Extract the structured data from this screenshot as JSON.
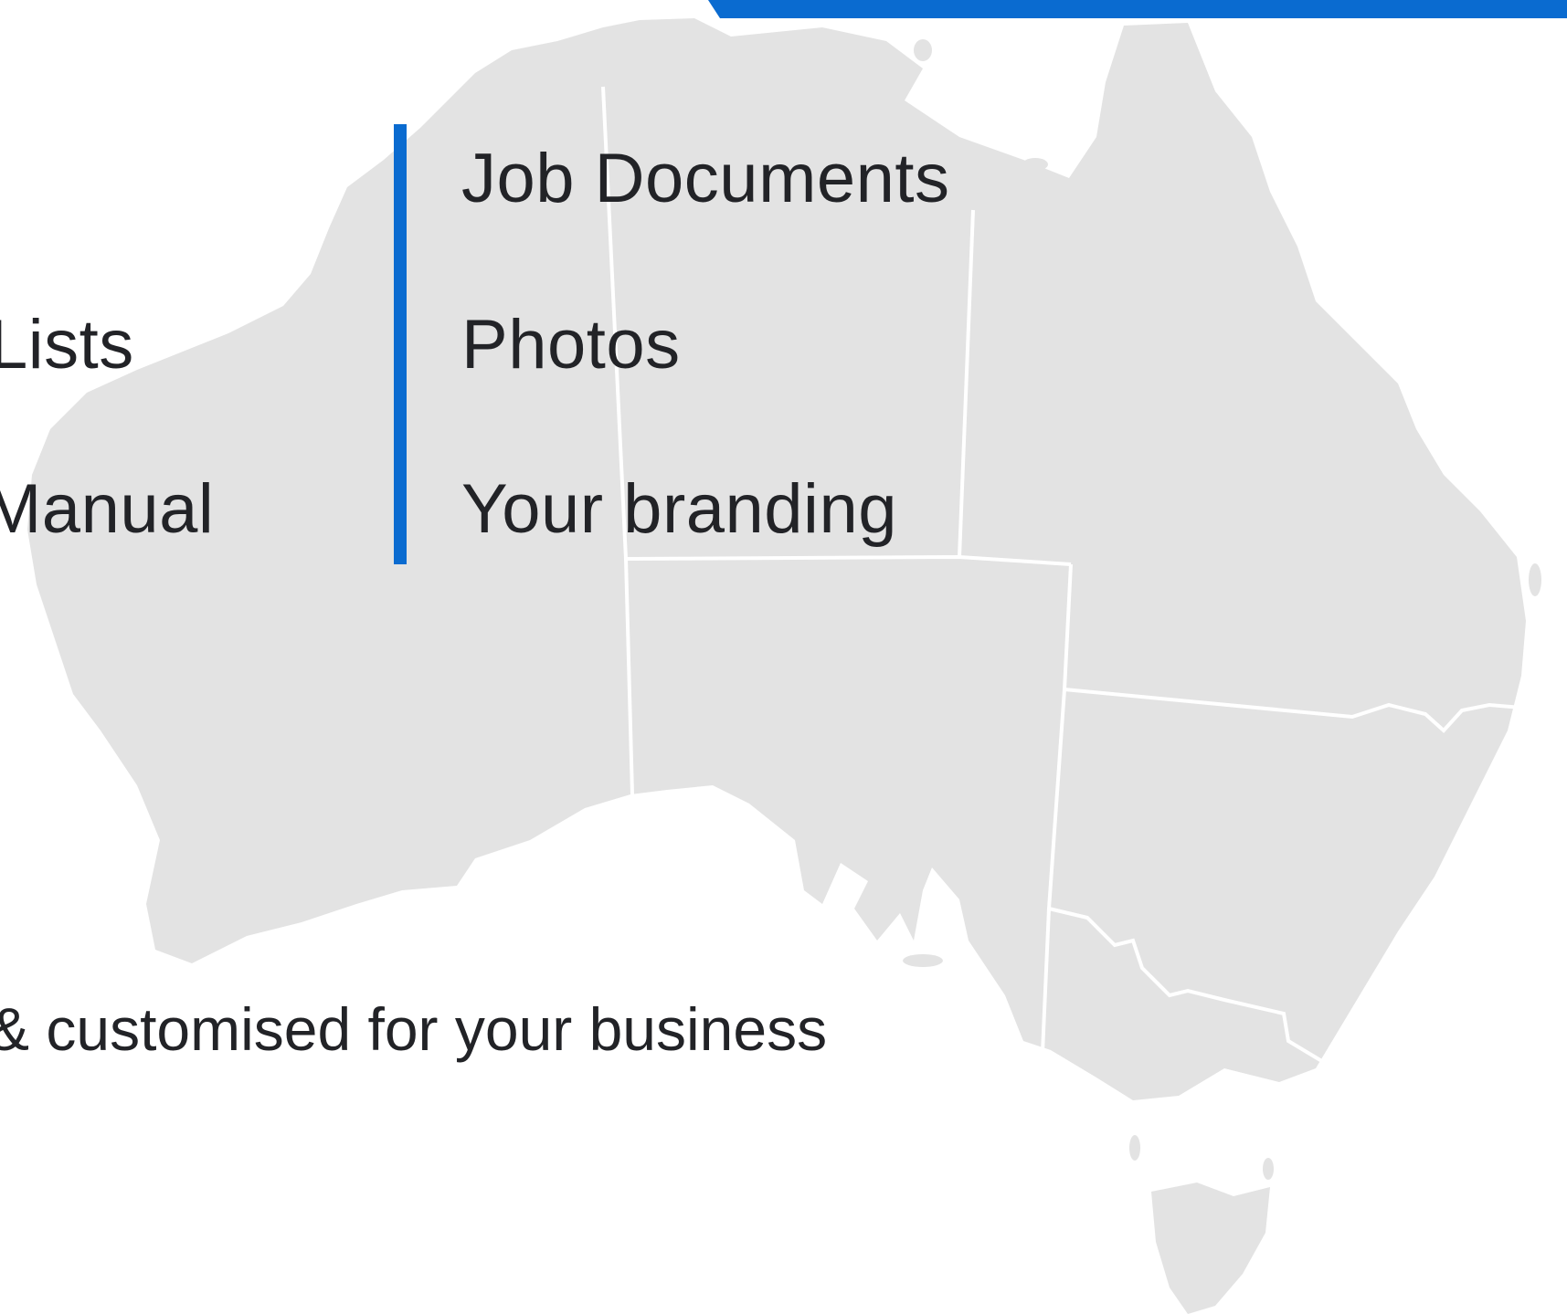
{
  "colors": {
    "accent": "#0a6bd0",
    "map_fill": "#e3e3e3",
    "map_border": "#ffffff",
    "text": "#222327",
    "background": "#ffffff"
  },
  "left_column": {
    "items": [
      {
        "label": "Lists"
      },
      {
        "label": "Manual"
      }
    ]
  },
  "right_column": {
    "items": [
      {
        "label": "Job Documents"
      },
      {
        "label": "Photos"
      },
      {
        "label": "Your branding"
      }
    ]
  },
  "tagline": "& customised for your business",
  "background_graphic": {
    "icon": "australia-map-icon"
  }
}
